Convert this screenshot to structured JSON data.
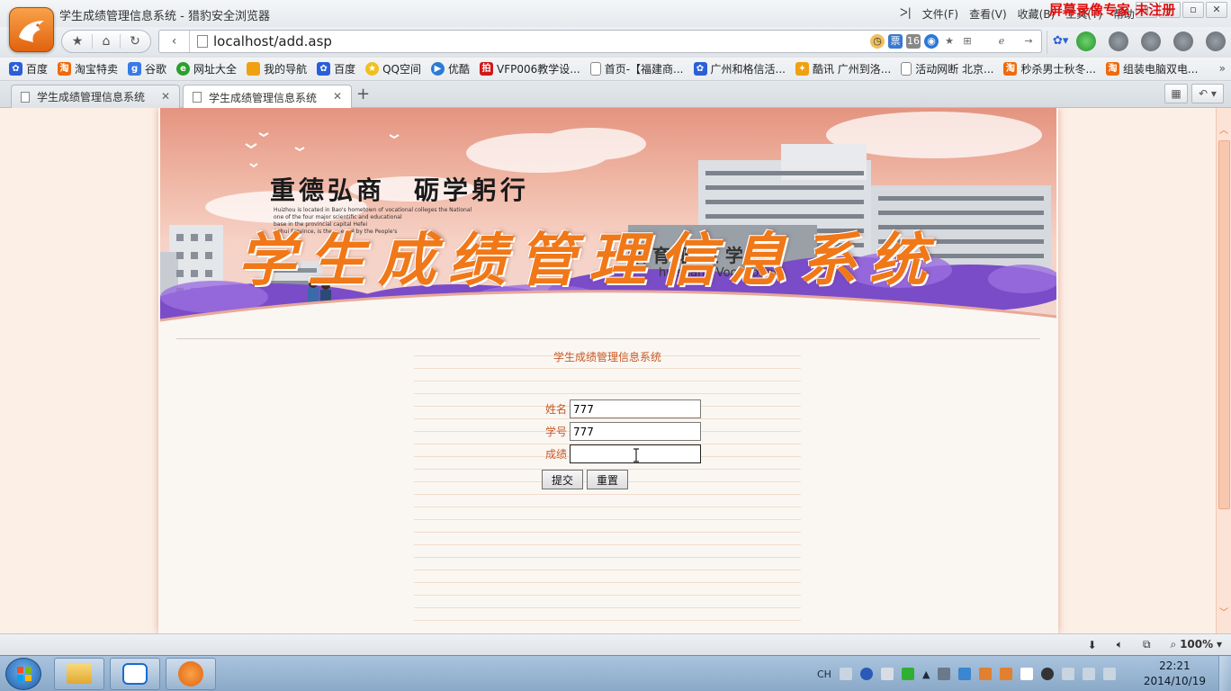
{
  "window": {
    "title": "学生成绩管理信息系统 - 猎豹安全浏览器",
    "menus": [
      "文件(F)",
      "查看(V)",
      "收藏(B)",
      "工具(T)",
      "帮助"
    ],
    "recorder_watermark": "屏幕录像专家 未注册"
  },
  "address_bar": {
    "url": "localhost/add.asp"
  },
  "bookmarks": [
    {
      "label": "百度",
      "color": "#2b5fd8",
      "icon": "paw-icon"
    },
    {
      "label": "淘宝特卖",
      "color": "#f06a0a",
      "icon": "taobao-icon"
    },
    {
      "label": "谷歌",
      "color": "#3a7ae8",
      "icon": "google-icon"
    },
    {
      "label": "网址大全",
      "color": "#2aa02a",
      "icon": "globe-icon"
    },
    {
      "label": "我的导航",
      "color": "#f0a010",
      "icon": "folder-icon"
    },
    {
      "label": "百度",
      "color": "#2b5fd8",
      "icon": "paw-icon"
    },
    {
      "label": "QQ空间",
      "color": "#f0c020",
      "icon": "star-icon"
    },
    {
      "label": "优酷",
      "color": "#2a7ad8",
      "icon": "play-icon"
    },
    {
      "label": "VFP006教学设...",
      "color": "#d01818",
      "icon": "red-icon"
    },
    {
      "label": "首页-【福建商...",
      "color": "#ffffff",
      "icon": "page-icon"
    },
    {
      "label": "广州和格信活...",
      "color": "#2b5fd8",
      "icon": "paw-icon"
    },
    {
      "label": "酷讯 广州到洛...",
      "color": "#f0a010",
      "icon": "kuxun-icon"
    },
    {
      "label": "活动网断 北京...",
      "color": "#ffffff",
      "icon": "page-icon"
    },
    {
      "label": "秒杀男士秋冬...",
      "color": "#f06a0a",
      "icon": "taobao-icon"
    },
    {
      "label": "组装电脑双电...",
      "color": "#f06a0a",
      "icon": "taobao-icon"
    }
  ],
  "tabs": [
    {
      "label": "学生成绩管理信息系统",
      "active": false
    },
    {
      "label": "学生成绩管理信息系统",
      "active": true
    }
  ],
  "form": {
    "title": "学生成绩管理信息系统",
    "fields": [
      {
        "label": "姓名",
        "value": "777"
      },
      {
        "label": "学号",
        "value": "777"
      },
      {
        "label": "成绩",
        "value": ""
      }
    ],
    "submit_label": "提交",
    "reset_label": "重置"
  },
  "banner": {
    "motto": "重德弘商　砺学躬行",
    "heading": "学生成绩管理信息系统",
    "caption_lines": [
      "Huizhou is located in Bao's hometown of vocational colleges the National",
      "one of the four major scientific and educational",
      "base in the provincial capital Hefei",
      "Anhui Province, is the ... enrol by the People's"
    ],
    "building_text": "教 育 职 业 学 院",
    "building_sub": "huishang Vocational"
  },
  "statusbar": {
    "zoom": "100%"
  },
  "taskbar": {
    "input_lang": "CH",
    "time": "22:21",
    "date": "2014/10/19"
  },
  "colors": {
    "form_text": "#c85a2a",
    "heading_orange": "#f07818",
    "recorder_red": "#e01010"
  }
}
